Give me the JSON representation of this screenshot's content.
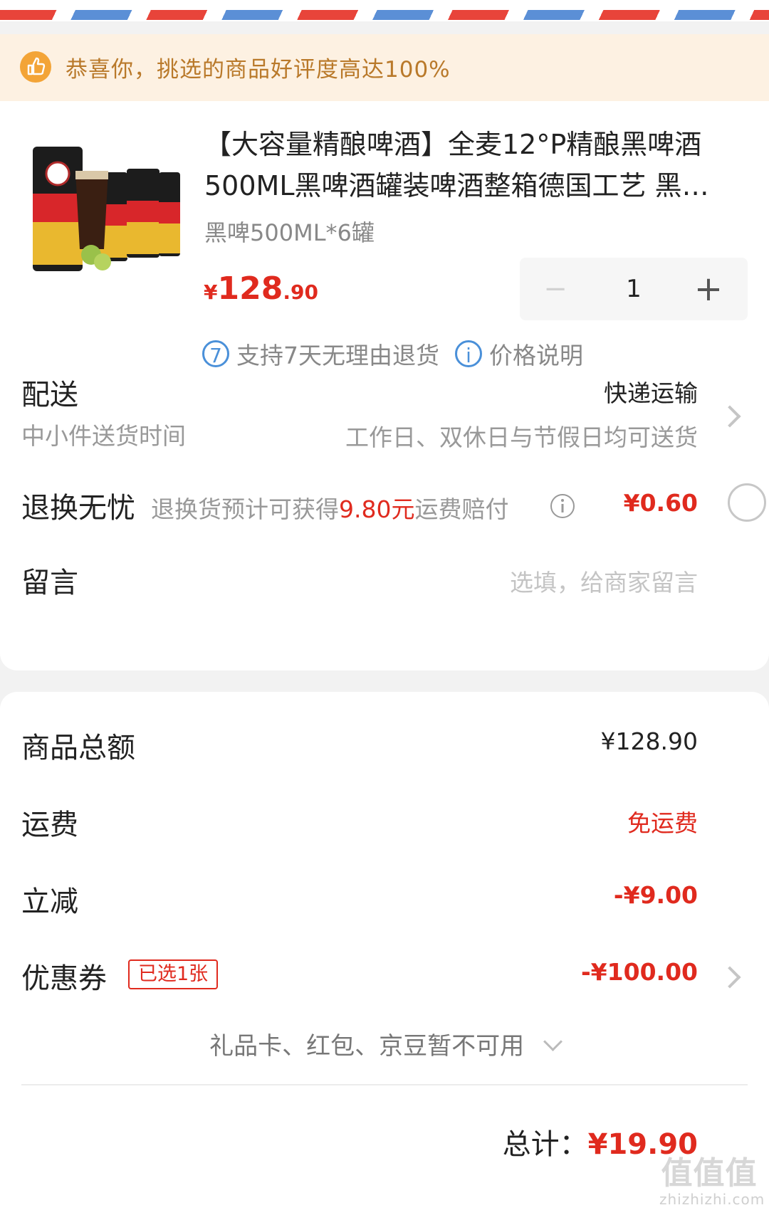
{
  "banner": {
    "text": "恭喜你，挑选的商品好评度高达100%",
    "icon": "thumbs-up-icon"
  },
  "product": {
    "title_line1": "【大容量精酿啤酒】全麦12°P精酿黑啤酒",
    "title_line2": "500ML黑啤酒罐装啤酒整箱德国工艺 黑…",
    "spec": "黑啤500ML*6罐",
    "price_currency": "¥",
    "price_int": "128",
    "price_dec": ".90",
    "quantity": "1",
    "minus": "−",
    "plus": "+",
    "badge_return_icon": "7",
    "badge_return": "支持7天无理由退货",
    "badge_price_icon": "i",
    "badge_price": "价格说明"
  },
  "delivery": {
    "label": "配送",
    "value": "快递运输",
    "sub_label": "中小件送货时间",
    "sub_value": "工作日、双休日与节假日均可送货"
  },
  "return_ins": {
    "label": "退换无忧",
    "desc_prefix": "退换货预计可获得",
    "desc_amount": "9.80元",
    "desc_suffix": "运费赔付",
    "price": "¥0.60"
  },
  "message": {
    "label": "留言",
    "placeholder": "选填，给商家留言"
  },
  "summary": {
    "goods_label": "商品总额",
    "goods_value": "¥128.90",
    "shipping_label": "运费",
    "shipping_value": "免运费",
    "discount_label": "立减",
    "discount_value": "-¥9.00",
    "coupon_label": "优惠券",
    "coupon_tag": "已选1张",
    "coupon_value": "-¥100.00",
    "gift_text": "礼品卡、红包、京豆暂不可用",
    "total_label": "总计：",
    "total_value": "¥19.90"
  },
  "watermark": {
    "mark": "值值值",
    "text": "zhizhizhi.com"
  },
  "colors": {
    "accent": "#e02a1e",
    "banner_bg": "#fdf1e2",
    "banner_text": "#b9792a",
    "link_blue": "#4a90d9"
  }
}
